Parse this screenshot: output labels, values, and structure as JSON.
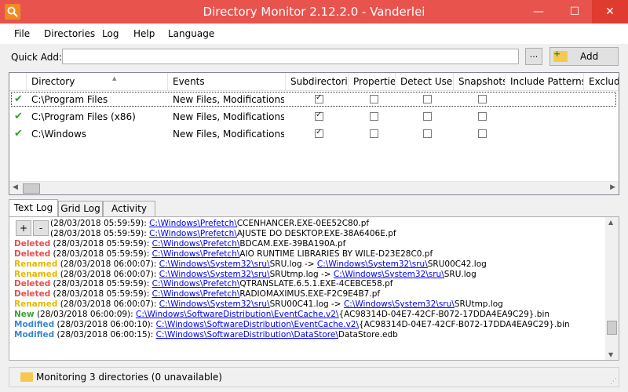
{
  "window": {
    "title": "Directory Monitor 2.12.2.0 - Vanderlei",
    "min": "—",
    "max": "☐",
    "close": "✕"
  },
  "menu": [
    "File",
    "Directories",
    "Log",
    "Help",
    "Language"
  ],
  "quick_add": {
    "label": "Quick Add:",
    "value": "",
    "browse": "...",
    "add": "Add"
  },
  "grid": {
    "columns": [
      "Directory",
      "Events",
      "Subdirectories",
      "Properties",
      "Detect Users",
      "Snapshots",
      "Include Patterns",
      "Exclude"
    ],
    "rows": [
      {
        "directory": "C:\\Program Files",
        "events": "New Files, Modifications, D...",
        "sub": true,
        "props": false,
        "users": false,
        "snaps": false,
        "selected": true
      },
      {
        "directory": "C:\\Program Files (x86)",
        "events": "New Files, Modifications, D...",
        "sub": true,
        "props": false,
        "users": false,
        "snaps": false,
        "selected": false
      },
      {
        "directory": "C:\\Windows",
        "events": "New Files, Modifications, D...",
        "sub": true,
        "props": false,
        "users": false,
        "snaps": false,
        "selected": false
      }
    ]
  },
  "tabs": [
    "Text Log",
    "Grid Log",
    "Activity Log"
  ],
  "zoom": {
    "plus": "+",
    "minus": "-"
  },
  "log": [
    {
      "type": "",
      "ts": "(28/03/2018 05:59:59): ",
      "parts": [
        [
          "l",
          "C:\\Windows\\Prefetch\\"
        ],
        [
          "t",
          "CCENHANCER.EXE-0EE52C80.pf"
        ]
      ]
    },
    {
      "type": "",
      "ts": "(28/03/2018 05:59:59): ",
      "parts": [
        [
          "l",
          "C:\\Windows\\Prefetch\\"
        ],
        [
          "t",
          "AJUSTE DO DESKTOP.EXE-38A6406E.pf"
        ]
      ]
    },
    {
      "type": "Deleted",
      "ts": " (28/03/2018 05:59:59): ",
      "parts": [
        [
          "l",
          "C:\\Windows\\Prefetch\\"
        ],
        [
          "t",
          "BDCAM.EXE-39BA190A.pf"
        ]
      ]
    },
    {
      "type": "Deleted",
      "ts": " (28/03/2018 05:59:59): ",
      "parts": [
        [
          "l",
          "C:\\Windows\\Prefetch\\"
        ],
        [
          "t",
          "AIO RUNTIME LIBRARIES BY WILE-D23E28C0.pf"
        ]
      ]
    },
    {
      "type": "Renamed",
      "ts": " (28/03/2018 06:00:07): ",
      "parts": [
        [
          "l",
          "C:\\Windows\\System32\\sru\\"
        ],
        [
          "t",
          "SRU.log -> "
        ],
        [
          "l",
          "C:\\Windows\\System32\\sru\\"
        ],
        [
          "t",
          "SRU00C42.log"
        ]
      ]
    },
    {
      "type": "Renamed",
      "ts": " (28/03/2018 06:00:07): ",
      "parts": [
        [
          "l",
          "C:\\Windows\\System32\\sru\\"
        ],
        [
          "t",
          "SRUtmp.log -> "
        ],
        [
          "l",
          "C:\\Windows\\System32\\sru\\"
        ],
        [
          "t",
          "SRU.log"
        ]
      ]
    },
    {
      "type": "Deleted",
      "ts": " (28/03/2018 05:59:59): ",
      "parts": [
        [
          "l",
          "C:\\Windows\\Prefetch\\"
        ],
        [
          "t",
          "QTRANSLATE.6.5.1.EXE-4CEBCE58.pf"
        ]
      ]
    },
    {
      "type": "Deleted",
      "ts": " (28/03/2018 05:59:59): ",
      "parts": [
        [
          "l",
          "C:\\Windows\\Prefetch\\"
        ],
        [
          "t",
          "RADIOMAXIMUS.EXE-F2C9E4B7.pf"
        ]
      ]
    },
    {
      "type": "Renamed",
      "ts": " (28/03/2018 06:00:07): ",
      "parts": [
        [
          "l",
          "C:\\Windows\\System32\\sru\\"
        ],
        [
          "t",
          "SRU00C41.log -> "
        ],
        [
          "l",
          "C:\\Windows\\System32\\sru\\"
        ],
        [
          "t",
          "SRUtmp.log"
        ]
      ]
    },
    {
      "type": "New",
      "ts": " (28/03/2018 06:00:09): ",
      "parts": [
        [
          "l",
          "C:\\Windows\\SoftwareDistribution\\EventCache.v2\\"
        ],
        [
          "t",
          "{AC98314D-04E7-42CF-B072-17DDA4EA9C29}.bin"
        ]
      ]
    },
    {
      "type": "Modified",
      "ts": " (28/03/2018 06:00:10): ",
      "parts": [
        [
          "l",
          "C:\\Windows\\SoftwareDistribution\\EventCache.v2\\"
        ],
        [
          "t",
          "{AC98314D-04E7-42CF-B072-17DDA4EA9C29}.bin"
        ]
      ]
    },
    {
      "type": "Modified",
      "ts": " (28/03/2018 06:00:15): ",
      "parts": [
        [
          "l",
          "C:\\Windows\\SoftwareDistribution\\DataStore\\"
        ],
        [
          "t",
          "DataStore.edb"
        ]
      ]
    }
  ],
  "status": {
    "text": "Monitoring 3 directories (0 unavailable)"
  },
  "colors": {
    "titlebar": "#e8534e",
    "deleted": "#e44e4e",
    "renamed": "#e6b800",
    "new": "#3aa13a",
    "modified": "#3b88cf",
    "link": "#0000ee"
  }
}
